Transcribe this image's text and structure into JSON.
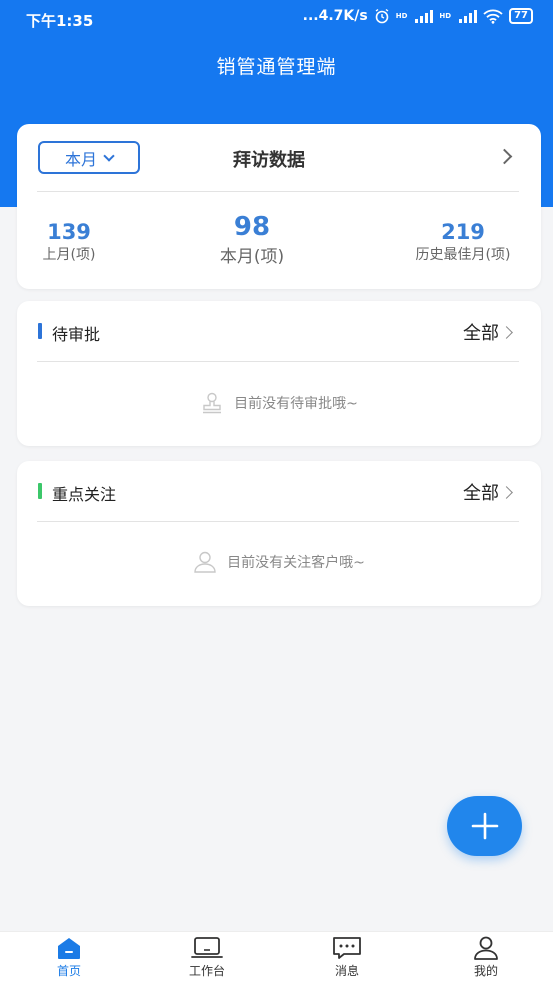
{
  "status_bar": {
    "time": "下午1:35",
    "net_speed": "...4.7K/s",
    "battery": "77",
    "hd1": "HD",
    "hd2": "HD"
  },
  "header": {
    "title": "销管通管理端"
  },
  "visit_card": {
    "month_selector": "本月",
    "title": "拜访数据",
    "stats": [
      {
        "value": "139",
        "label": "上月(项)"
      },
      {
        "value": "98",
        "label": "本月(项)"
      },
      {
        "value": "219",
        "label": "历史最佳月(项)"
      }
    ]
  },
  "pending": {
    "title": "待审批",
    "all_label": "全部",
    "empty_text": "目前没有待审批哦~",
    "accent": "#2d74d8"
  },
  "focus": {
    "title": "重点关注",
    "all_label": "全部",
    "empty_text": "目前没有关注客户哦~",
    "accent": "#3cc76a"
  },
  "fab": {
    "icon": "plus-icon"
  },
  "tabbar": [
    {
      "label": "首页",
      "icon": "home-icon",
      "active": true
    },
    {
      "label": "工作台",
      "icon": "laptop-icon",
      "active": false
    },
    {
      "label": "消息",
      "icon": "message-icon",
      "active": false
    },
    {
      "label": "我的",
      "icon": "person-icon",
      "active": false
    }
  ],
  "colors": {
    "primary": "#1578f0",
    "stat_blue": "#3a7fd5",
    "fab": "#2186ec"
  }
}
